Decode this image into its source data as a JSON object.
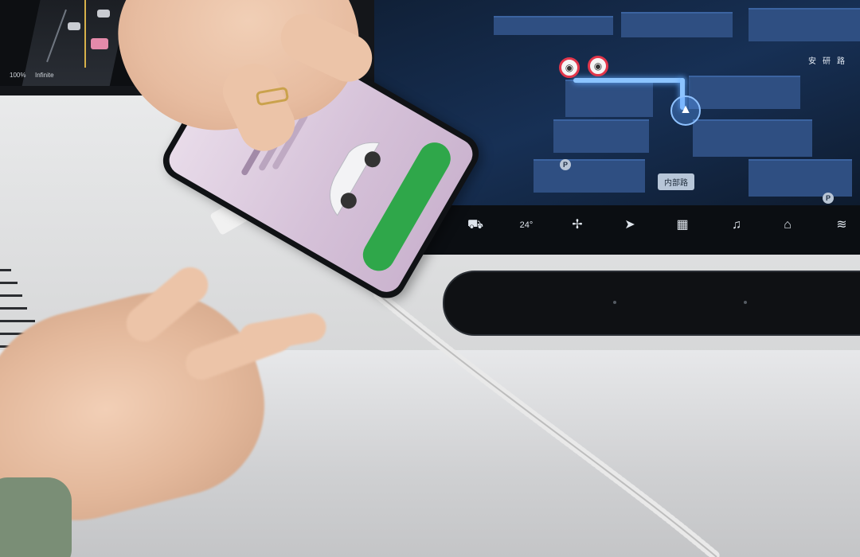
{
  "cluster": {
    "battery": "100%",
    "range_text": "Infinite"
  },
  "map": {
    "road_label": "内部路",
    "street_label": "安研路",
    "poi_marker": "P"
  },
  "dock": {
    "temperature": "24°",
    "icons": [
      "car-icon",
      "temperature",
      "fan-icon",
      "navigation-icon",
      "apps-grid-icon",
      "music-icon",
      "car-seat-icon",
      "defrost-icon"
    ]
  },
  "phone": {
    "app": "vehicle-control-app"
  },
  "colors": {
    "map_blocks": "#2f4f82",
    "route": "#8cc4ff",
    "camera_ring": "#e2364b",
    "phone_button": "#2fa74a"
  }
}
